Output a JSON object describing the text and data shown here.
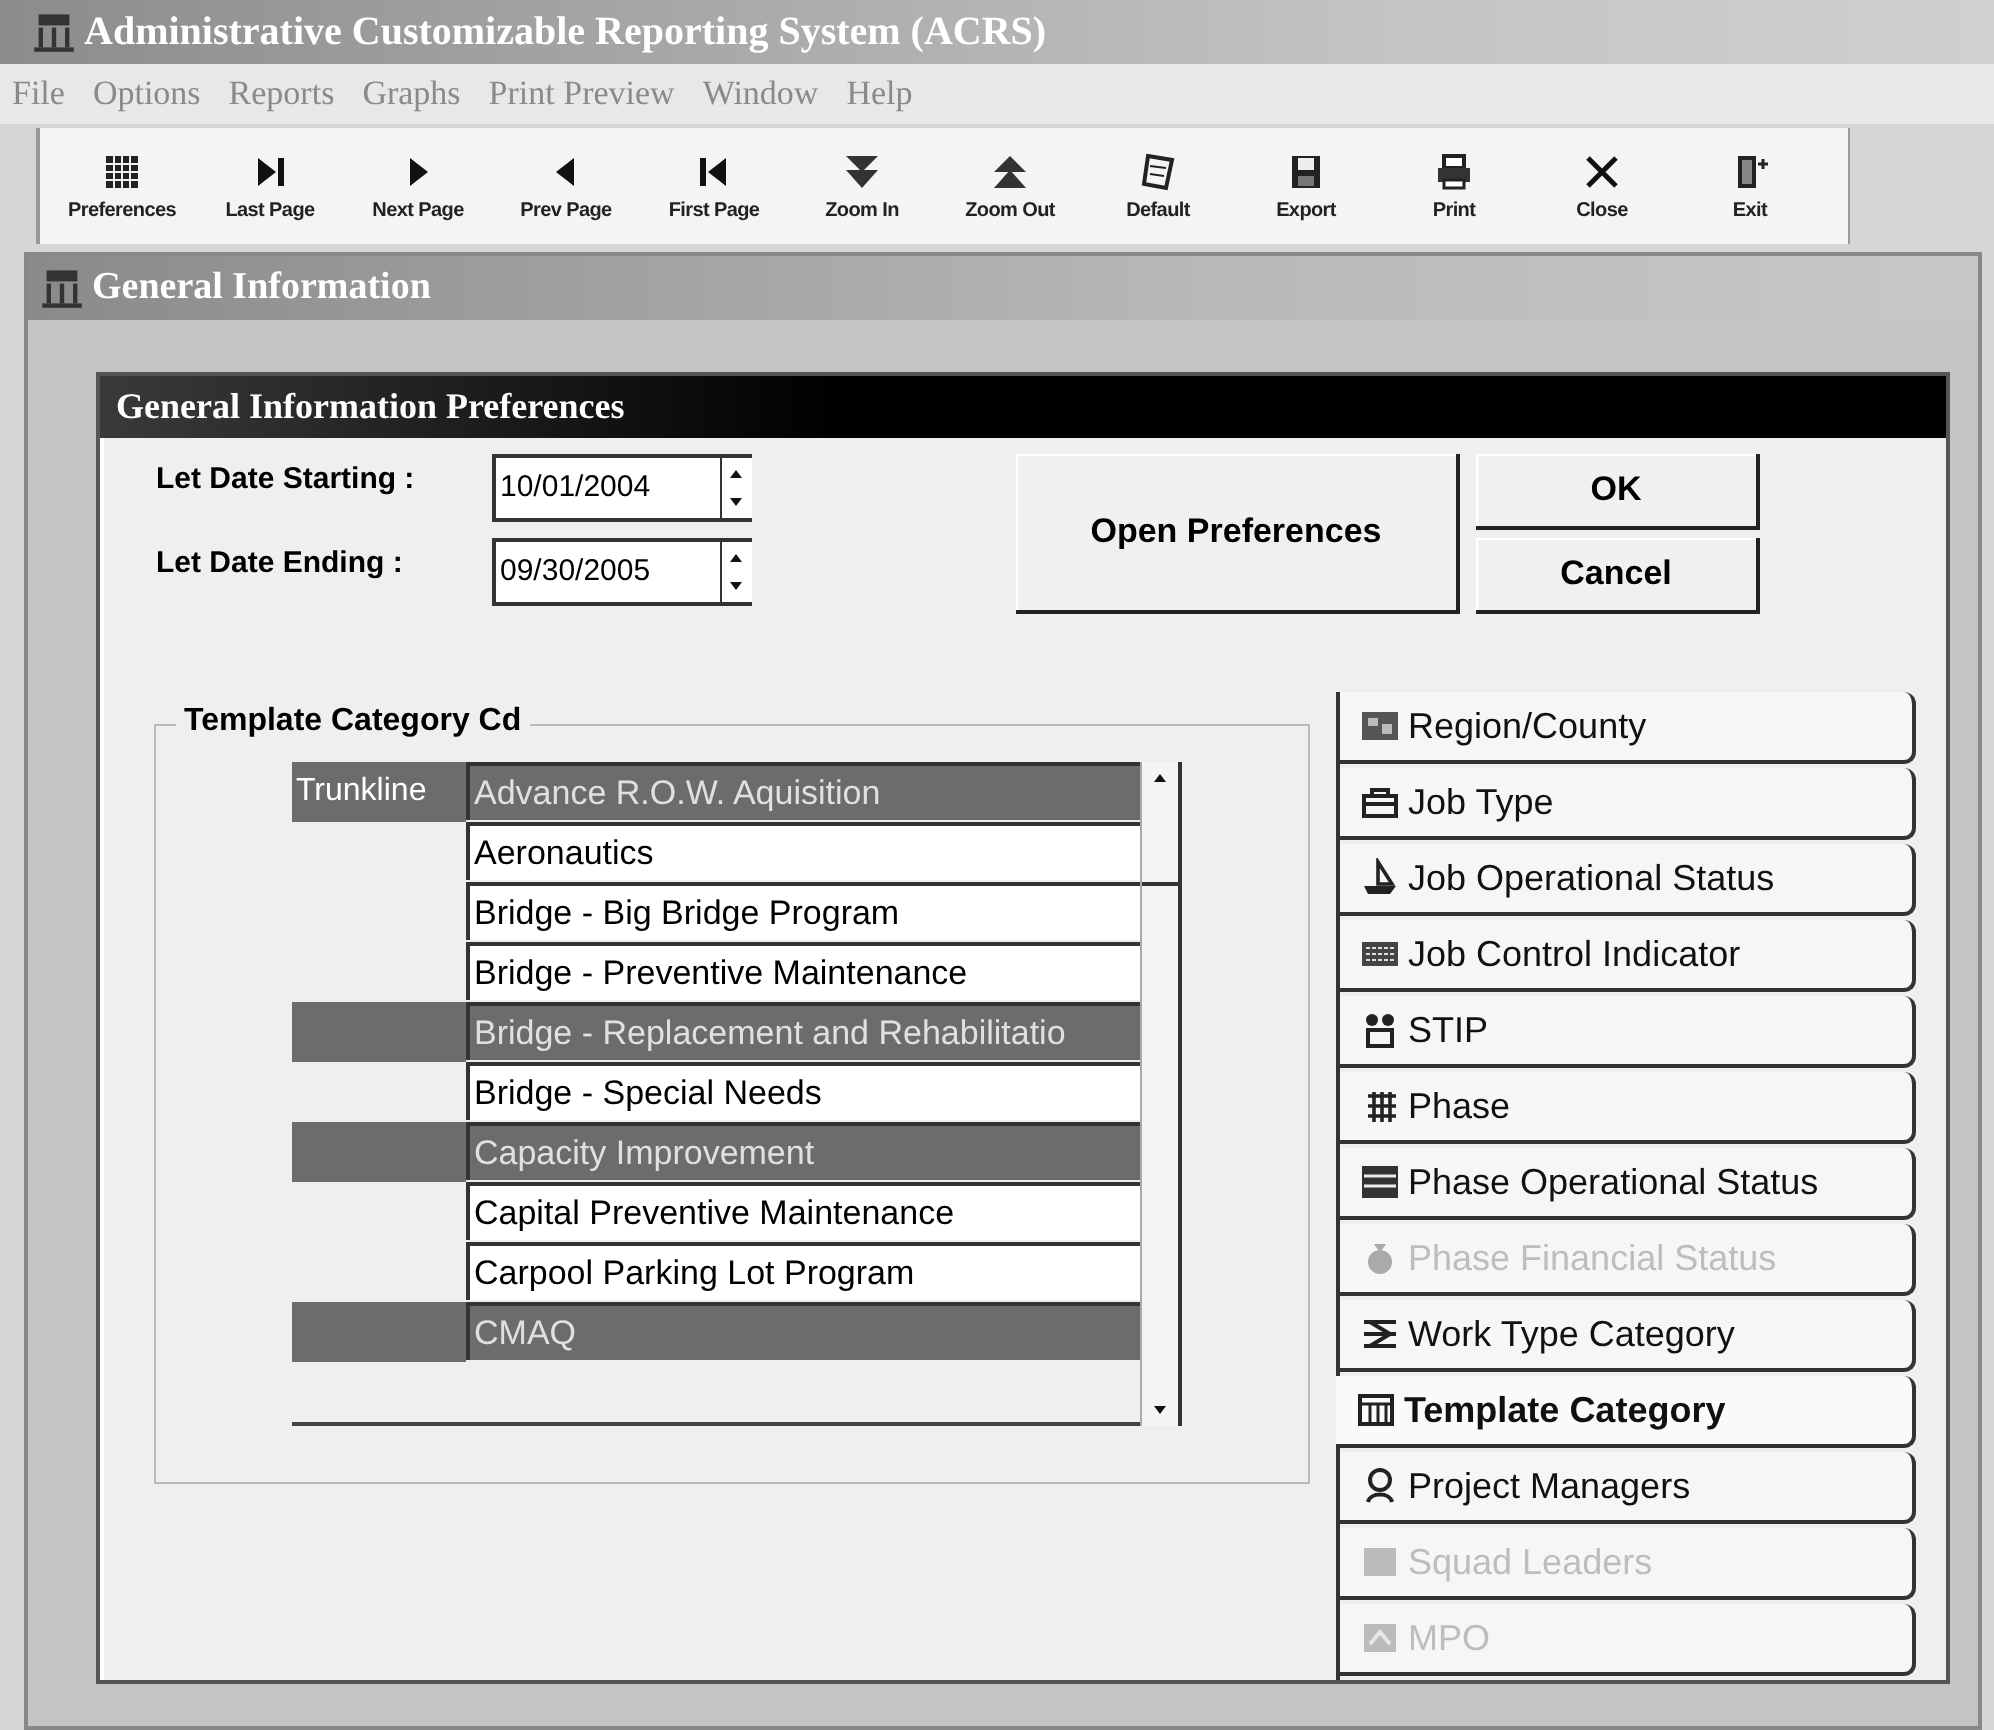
{
  "window": {
    "title": "Administrative Customizable Reporting System (ACRS)"
  },
  "menu": [
    "File",
    "Options",
    "Reports",
    "Graphs",
    "Print Preview",
    "Window",
    "Help"
  ],
  "toolbar": [
    {
      "label": "Preferences"
    },
    {
      "label": "Last Page"
    },
    {
      "label": "Next Page"
    },
    {
      "label": "Prev Page"
    },
    {
      "label": "First Page"
    },
    {
      "label": "Zoom In"
    },
    {
      "label": "Zoom Out"
    },
    {
      "label": "Default"
    },
    {
      "label": "Export"
    },
    {
      "label": "Print"
    },
    {
      "label": "Close"
    },
    {
      "label": "Exit"
    }
  ],
  "child_window": {
    "title": "General Information"
  },
  "dialog": {
    "title": "General Information Preferences",
    "fields": [
      {
        "label": "Let Date Starting :",
        "value": "10/01/2004"
      },
      {
        "label": "Let Date Ending :",
        "value": "09/30/2005"
      }
    ],
    "buttons": [
      "Open Preferences",
      "OK",
      "Cancel"
    ],
    "group": {
      "title": "Template Category Cd",
      "rows": [
        {
          "column_1": "Trunkline",
          "name": "Advance R.O.W. Aquisition",
          "selected": true
        },
        {
          "name": "Aeronautics",
          "selected": false
        },
        {
          "name": "Bridge - Big Bridge Program",
          "selected": false
        },
        {
          "name": "Bridge - Preventive Maintenance",
          "selected": false
        },
        {
          "name": "Bridge - Replacement and Rehabilitatio",
          "selected": true
        },
        {
          "name": "Bridge - Special Needs",
          "selected": false
        },
        {
          "name": "Capacity Improvement",
          "selected": true
        },
        {
          "name": "Capital Preventive Maintenance",
          "selected": false
        },
        {
          "name": "Carpool Parking Lot Program",
          "selected": false
        },
        {
          "name": "CMAQ",
          "selected": true
        }
      ]
    },
    "tabs": [
      {
        "label": "Region/County",
        "selected": false,
        "disabled": false
      },
      {
        "label": "Job Type",
        "selected": false,
        "disabled": false
      },
      {
        "label": "Job Operational Status",
        "selected": false,
        "disabled": false
      },
      {
        "label": "Job Control Indicator",
        "selected": false,
        "disabled": false
      },
      {
        "label": "STIP",
        "selected": false,
        "disabled": false
      },
      {
        "label": "Phase",
        "selected": false,
        "disabled": false
      },
      {
        "label": "Phase Operational Status",
        "selected": false,
        "disabled": false
      },
      {
        "label": "Phase Financial Status",
        "selected": false,
        "disabled": true
      },
      {
        "label": "Work Type Category",
        "selected": false,
        "disabled": false
      },
      {
        "label": "Template Category",
        "selected": true,
        "disabled": false
      },
      {
        "label": "Project Managers",
        "selected": false,
        "disabled": false
      },
      {
        "label": "Squad Leaders",
        "selected": false,
        "disabled": true
      },
      {
        "label": "MPO",
        "selected": false,
        "disabled": true
      }
    ]
  }
}
